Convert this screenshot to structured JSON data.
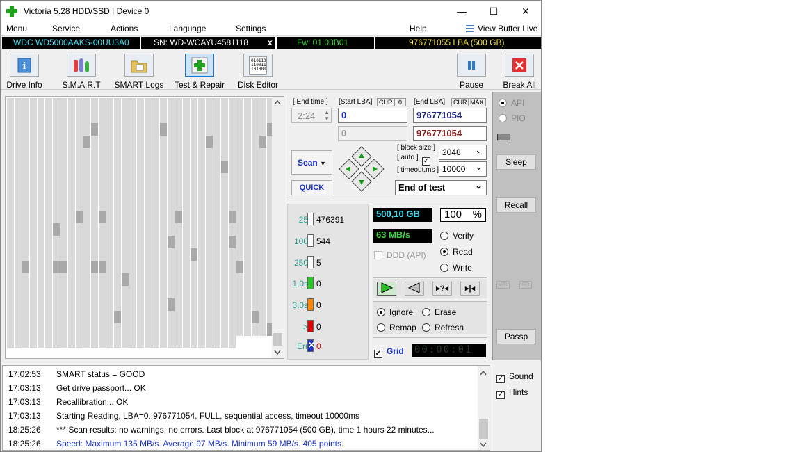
{
  "window": {
    "title": "Victoria 5.28 HDD/SSD | Device 0",
    "minimize": "—",
    "maximize": "☐",
    "close": "✕"
  },
  "menu": {
    "items": [
      "Menu",
      "Service",
      "Actions",
      "Language",
      "Settings",
      "Help"
    ],
    "view_buffer": "View Buffer Live"
  },
  "drive": {
    "model": "WDC WD5000AAKS-00UU3A0",
    "serial": "SN: WD-WCAYU4581118",
    "close_x": "x",
    "firmware": "Fw: 01.03B01",
    "lba": "976771055 LBA (500 GB)"
  },
  "toolbar": {
    "buttons": [
      "Drive Info",
      "S.M.A.R.T",
      "SMART Logs",
      "Test & Repair",
      "Disk Editor"
    ],
    "pause": "Pause",
    "break_all": "Break All"
  },
  "scan_settings": {
    "end_time_label": "[ End time ]",
    "end_time_value": "2:24",
    "start_lba_label": "[Start LBA]",
    "cur_label": "CUR",
    "cur_value": "0",
    "end_lba_label": "[End LBA]",
    "end_cur_label": "CUR",
    "max_label": "MAX",
    "start_lba": "0",
    "end_lba": "976771054",
    "start_lba_2": "0",
    "end_lba_2": "976771054",
    "scan_button": "Scan",
    "quick_button": "QUICK",
    "block_size_label": "[ block size ]",
    "auto_label": "[ auto ]",
    "block_size": "2048",
    "timeout_label": "[ timeout,ms ]",
    "timeout": "10000",
    "end_action": "End of test"
  },
  "stats": [
    {
      "key": "25",
      "value": "476391",
      "color": "#ffffff"
    },
    {
      "key": "100",
      "value": "544",
      "color": "#ffffff"
    },
    {
      "key": "250",
      "value": "5",
      "color": "#ffffff"
    },
    {
      "key": "1,0s",
      "value": "0",
      "color": "#22cc22"
    },
    {
      "key": "3,0s",
      "value": "0",
      "color": "#ff8800"
    },
    {
      "key": ">",
      "value": "0",
      "color": "#e00000"
    },
    {
      "key": "Err",
      "value": "0",
      "color": "#1a30c8"
    }
  ],
  "progress": {
    "size": "500,10 GB",
    "percent": "100",
    "percent_sign": "%",
    "speed": "63 MB/s",
    "ddd": "DDD (API)"
  },
  "mode": {
    "verify": "Verify",
    "read": "Read",
    "write": "Write"
  },
  "repair": {
    "ignore": "Ignore",
    "erase": "Erase",
    "remap": "Remap",
    "refresh": "Refresh"
  },
  "grid_label": "Grid",
  "timer": "00:00:01",
  "right_panel": {
    "api": "API",
    "pio": "PIO",
    "sleep": "Sleep",
    "recall": "Recall",
    "wr": "WR",
    "rd": "RD",
    "passp": "Passp"
  },
  "log": [
    {
      "time": "17:02:53",
      "text": "SMART status = GOOD",
      "color": "#000000"
    },
    {
      "time": "17:03:13",
      "text": "Get drive passport... OK",
      "color": "#000000"
    },
    {
      "time": "17:03:13",
      "text": "Recallibration... OK",
      "color": "#000000"
    },
    {
      "time": "17:03:13",
      "text": "Starting Reading, LBA=0..976771054, FULL, sequential access, timeout 10000ms",
      "color": "#000000"
    },
    {
      "time": "18:25:26",
      "text": "*** Scan results: no warnings, no errors. Last block at 976771054 (500 GB), time 1 hours 22 minutes...",
      "color": "#000000"
    },
    {
      "time": "18:25:26",
      "text": "Speed: Maximum 135 MB/s. Average 97 MB/s. Minimum 59 MB/s. 405 points.",
      "color": "#1a30c8"
    }
  ],
  "options": {
    "sound": "Sound",
    "hints": "Hints"
  }
}
